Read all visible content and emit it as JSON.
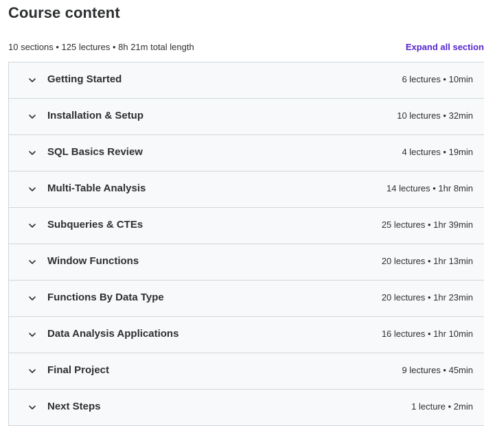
{
  "header": {
    "title": "Course content",
    "summary": "10 sections • 125 lectures • 8h 21m total length",
    "expand_label": "Expand all section"
  },
  "colors": {
    "accent": "#5624d0",
    "text": "#2d2f31",
    "row_background": "#f7f9fa",
    "border": "#d1d7dc"
  },
  "sections": [
    {
      "title": "Getting Started",
      "meta": "6 lectures • 10min",
      "icon": "chevron-down-icon"
    },
    {
      "title": "Installation & Setup",
      "meta": "10 lectures • 32min",
      "icon": "chevron-down-icon"
    },
    {
      "title": "SQL Basics Review",
      "meta": "4 lectures • 19min",
      "icon": "chevron-down-icon"
    },
    {
      "title": "Multi-Table Analysis",
      "meta": "14 lectures • 1hr 8min",
      "icon": "chevron-down-icon"
    },
    {
      "title": "Subqueries & CTEs",
      "meta": "25 lectures • 1hr 39min",
      "icon": "chevron-down-icon"
    },
    {
      "title": "Window Functions",
      "meta": "20 lectures • 1hr 13min",
      "icon": "chevron-down-icon"
    },
    {
      "title": "Functions By Data Type",
      "meta": "20 lectures • 1hr 23min",
      "icon": "chevron-down-icon"
    },
    {
      "title": "Data Analysis Applications",
      "meta": "16 lectures • 1hr 10min",
      "icon": "chevron-down-icon"
    },
    {
      "title": "Final Project",
      "meta": "9 lectures • 45min",
      "icon": "chevron-down-icon"
    },
    {
      "title": "Next Steps",
      "meta": "1 lecture • 2min",
      "icon": "chevron-down-icon"
    }
  ]
}
